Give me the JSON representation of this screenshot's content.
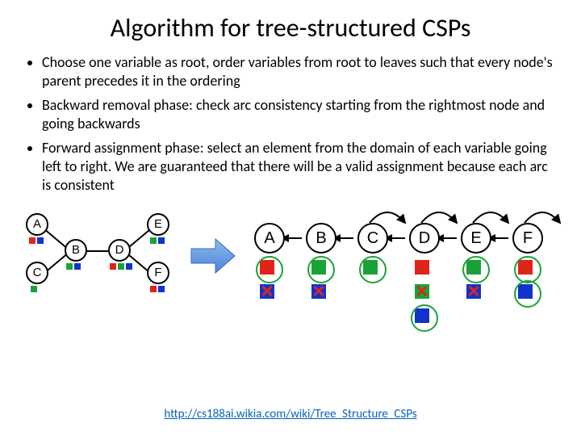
{
  "title": "Algorithm for tree-structured CSPs",
  "bullets": {
    "b1": "Choose one variable as root, order variables from root to leaves such that every node's parent precedes it in the ordering",
    "b2": "Backward removal phase: check arc consistency starting from the rightmost node and going backwards",
    "b3": "Forward assignment phase: select an element from the domain of each variable going left to right. We are guaranteed that there will be a valid assignment because each arc is consistent"
  },
  "tree_nodes": {
    "A": "A",
    "B": "B",
    "C": "C",
    "D": "D",
    "E": "E",
    "F": "F"
  },
  "chain_nodes": {
    "A": "A",
    "B": "B",
    "C": "C",
    "D": "D",
    "E": "E",
    "F": "F"
  },
  "link": {
    "text": "http://cs188ai.wikia.com/wiki/Tree_Structure_CSPs",
    "href": "http://cs188ai.wikia.com/wiki/Tree_Structure_CSPs"
  }
}
